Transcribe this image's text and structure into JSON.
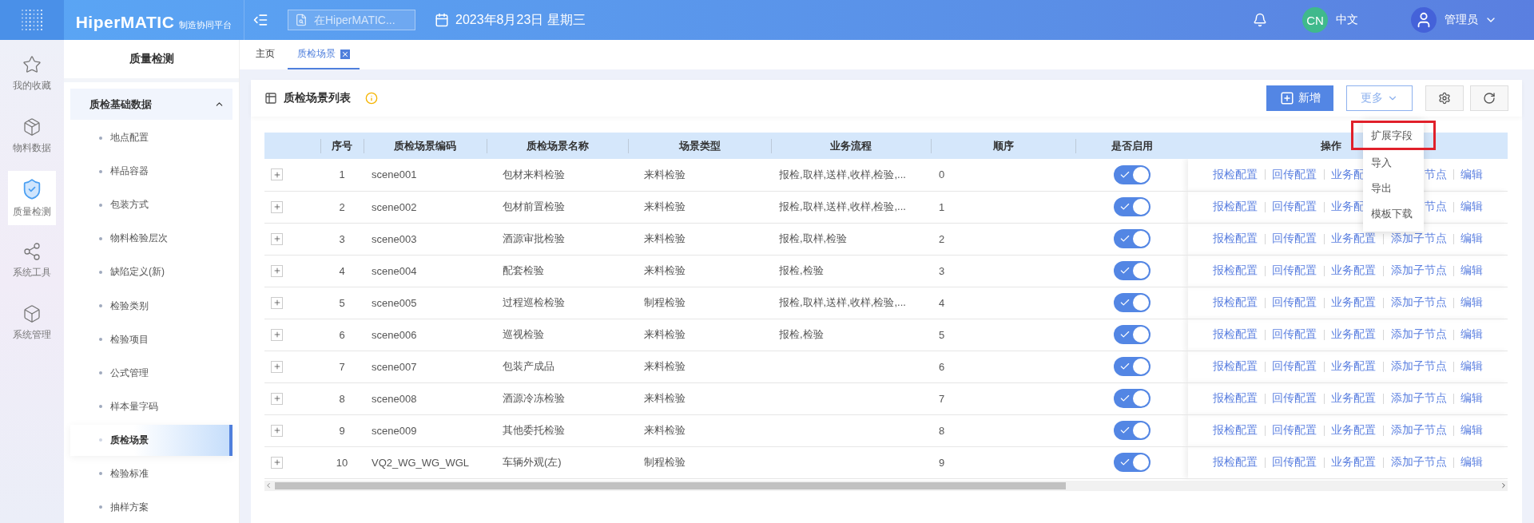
{
  "header": {
    "logo": "HiperMATIC",
    "logo_subtitle": "制造协同平台",
    "search": {
      "placeholder": "在HiperMATIC..."
    },
    "date": "2023年8月23日 星期三",
    "language_badge": "CN",
    "language": "中文",
    "user": "管理员"
  },
  "rail": [
    {
      "label": "我的收藏",
      "kind": "star",
      "selected": false
    },
    {
      "label": "物料数据",
      "kind": "box",
      "selected": false
    },
    {
      "label": "质量检测",
      "kind": "shield",
      "selected": true
    },
    {
      "label": "系统工具",
      "kind": "network",
      "selected": false
    },
    {
      "label": "系统管理",
      "kind": "cube",
      "selected": false
    }
  ],
  "sidebar": {
    "title": "质量检测",
    "group": {
      "label": "质检基础数据",
      "expanded": true,
      "items": [
        {
          "label": "地点配置",
          "selected": false
        },
        {
          "label": "样品容器",
          "selected": false
        },
        {
          "label": "包装方式",
          "selected": false
        },
        {
          "label": "物料检验层次",
          "selected": false
        },
        {
          "label": "缺陷定义(新)",
          "selected": false
        },
        {
          "label": "检验类别",
          "selected": false
        },
        {
          "label": "检验项目",
          "selected": false
        },
        {
          "label": "公式管理",
          "selected": false
        },
        {
          "label": "样本量字码",
          "selected": false
        },
        {
          "label": "质检场景",
          "selected": true
        },
        {
          "label": "检验标准",
          "selected": false
        },
        {
          "label": "抽样方案",
          "selected": false
        }
      ]
    }
  },
  "tabs": [
    {
      "label": "主页",
      "selected": false,
      "closable": false
    },
    {
      "label": "质检场景",
      "selected": true,
      "closable": true
    }
  ],
  "card": {
    "title": "质检场景列表",
    "buttons": [
      {
        "label": "新增",
        "kind": "primary"
      },
      {
        "label": "更多",
        "kind": "dropdown"
      },
      {
        "kind": "settings"
      },
      {
        "kind": "refresh"
      }
    ],
    "menu": [
      {
        "label": "扩展字段",
        "highlighted": true
      },
      {
        "label": "导入",
        "highlighted": false
      },
      {
        "label": "导出",
        "highlighted": false
      },
      {
        "label": "模板下载",
        "highlighted": false
      }
    ]
  },
  "table": {
    "columns": [
      "序号",
      "质检场景编码",
      "质检场景名称",
      "场景类型",
      "业务流程",
      "顺序",
      "是否启用",
      "操作"
    ],
    "rows": [
      {
        "index": "1",
        "code": "scene001",
        "name": "包材来料检验",
        "type": "来料检验",
        "flow": "报检,取样,送样,收样,检验,...",
        "order": "0",
        "enabled": true,
        "actions": [
          "报检配置",
          "回传配置",
          "业务配",
          "节点",
          "编辑"
        ]
      },
      {
        "index": "2",
        "code": "scene002",
        "name": "包材前置检验",
        "type": "来料检验",
        "flow": "报检,取样,送样,收样,检验,...",
        "order": "1",
        "enabled": true,
        "actions": [
          "报检配置",
          "回传配置",
          "业务配",
          "节点",
          "编辑"
        ]
      },
      {
        "index": "3",
        "code": "scene003",
        "name": "酒源审批检验",
        "type": "来料检验",
        "flow": "报检,取样,检验",
        "order": "2",
        "enabled": true,
        "actions": [
          "报检配置",
          "回传配置",
          "业务配置",
          "添加子节点",
          "编辑"
        ]
      },
      {
        "index": "4",
        "code": "scene004",
        "name": "配套检验",
        "type": "来料检验",
        "flow": "报检,检验",
        "order": "3",
        "enabled": true,
        "actions": [
          "报检配置",
          "回传配置",
          "业务配置",
          "添加子节点",
          "编辑"
        ]
      },
      {
        "index": "5",
        "code": "scene005",
        "name": "过程巡检检验",
        "type": "制程检验",
        "flow": "报检,取样,送样,收样,检验,...",
        "order": "4",
        "enabled": true,
        "actions": [
          "报检配置",
          "回传配置",
          "业务配置",
          "添加子节点",
          "编辑"
        ]
      },
      {
        "index": "6",
        "code": "scene006",
        "name": "巡视检验",
        "type": "来料检验",
        "flow": "报检,检验",
        "order": "5",
        "enabled": true,
        "actions": [
          "报检配置",
          "回传配置",
          "业务配置",
          "添加子节点",
          "编辑"
        ]
      },
      {
        "index": "7",
        "code": "scene007",
        "name": "包装产成品",
        "type": "来料检验",
        "order": "6",
        "enabled": true,
        "actions": [
          "报检配置",
          "回传配置",
          "业务配置",
          "添加子节点",
          "编辑"
        ]
      },
      {
        "index": "8",
        "code": "scene008",
        "name": "酒源冷冻检验",
        "type": "来料检验",
        "order": "7",
        "enabled": true,
        "actions": [
          "报检配置",
          "回传配置",
          "业务配置",
          "添加子节点",
          "编辑"
        ]
      },
      {
        "index": "9",
        "code": "scene009",
        "name": "其他委托检验",
        "type": "来料检验",
        "order": "8",
        "enabled": true,
        "actions": [
          "报检配置",
          "回传配置",
          "业务配置",
          "添加子节点",
          "编辑"
        ]
      },
      {
        "index": "10",
        "code": "VQ2_WG_WG_WGL",
        "name": "车辆外观(左)",
        "type": "制程检验",
        "order": "9",
        "enabled": true,
        "actions": [
          "报检配置",
          "回传配置",
          "业务配置",
          "添加子节点",
          "编辑"
        ]
      }
    ]
  }
}
